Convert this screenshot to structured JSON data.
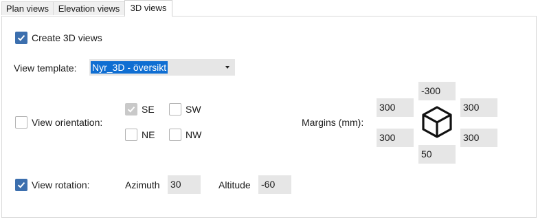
{
  "tabs": [
    {
      "label": "Plan views",
      "active": false
    },
    {
      "label": "Elevation views",
      "active": false
    },
    {
      "label": "3D views",
      "active": true
    }
  ],
  "create_3d": {
    "label": "Create 3D views",
    "checked": true
  },
  "view_template": {
    "label": "View template:",
    "value": "Nyr_3D - översikt"
  },
  "view_orientation": {
    "label": "View orientation:",
    "checked": false,
    "options": [
      {
        "label": "SE",
        "checked": true,
        "disabled": true
      },
      {
        "label": "SW",
        "checked": false
      },
      {
        "label": "NE",
        "checked": false
      },
      {
        "label": "NW",
        "checked": false
      }
    ]
  },
  "margins": {
    "label": "Margins (mm):",
    "top": "-300",
    "left_top": "300",
    "right_top": "300",
    "left_bottom": "300",
    "right_bottom": "300",
    "bottom": "50",
    "icon": "cube-icon"
  },
  "view_rotation": {
    "label": "View rotation:",
    "checked": true,
    "azimuth_label": "Azimuth",
    "azimuth": "30",
    "altitude_label": "Altitude",
    "altitude": "-60"
  },
  "colors": {
    "accent": "#3c6fae",
    "selection": "#0f6ed2",
    "field_bg": "#e6e6e6"
  }
}
